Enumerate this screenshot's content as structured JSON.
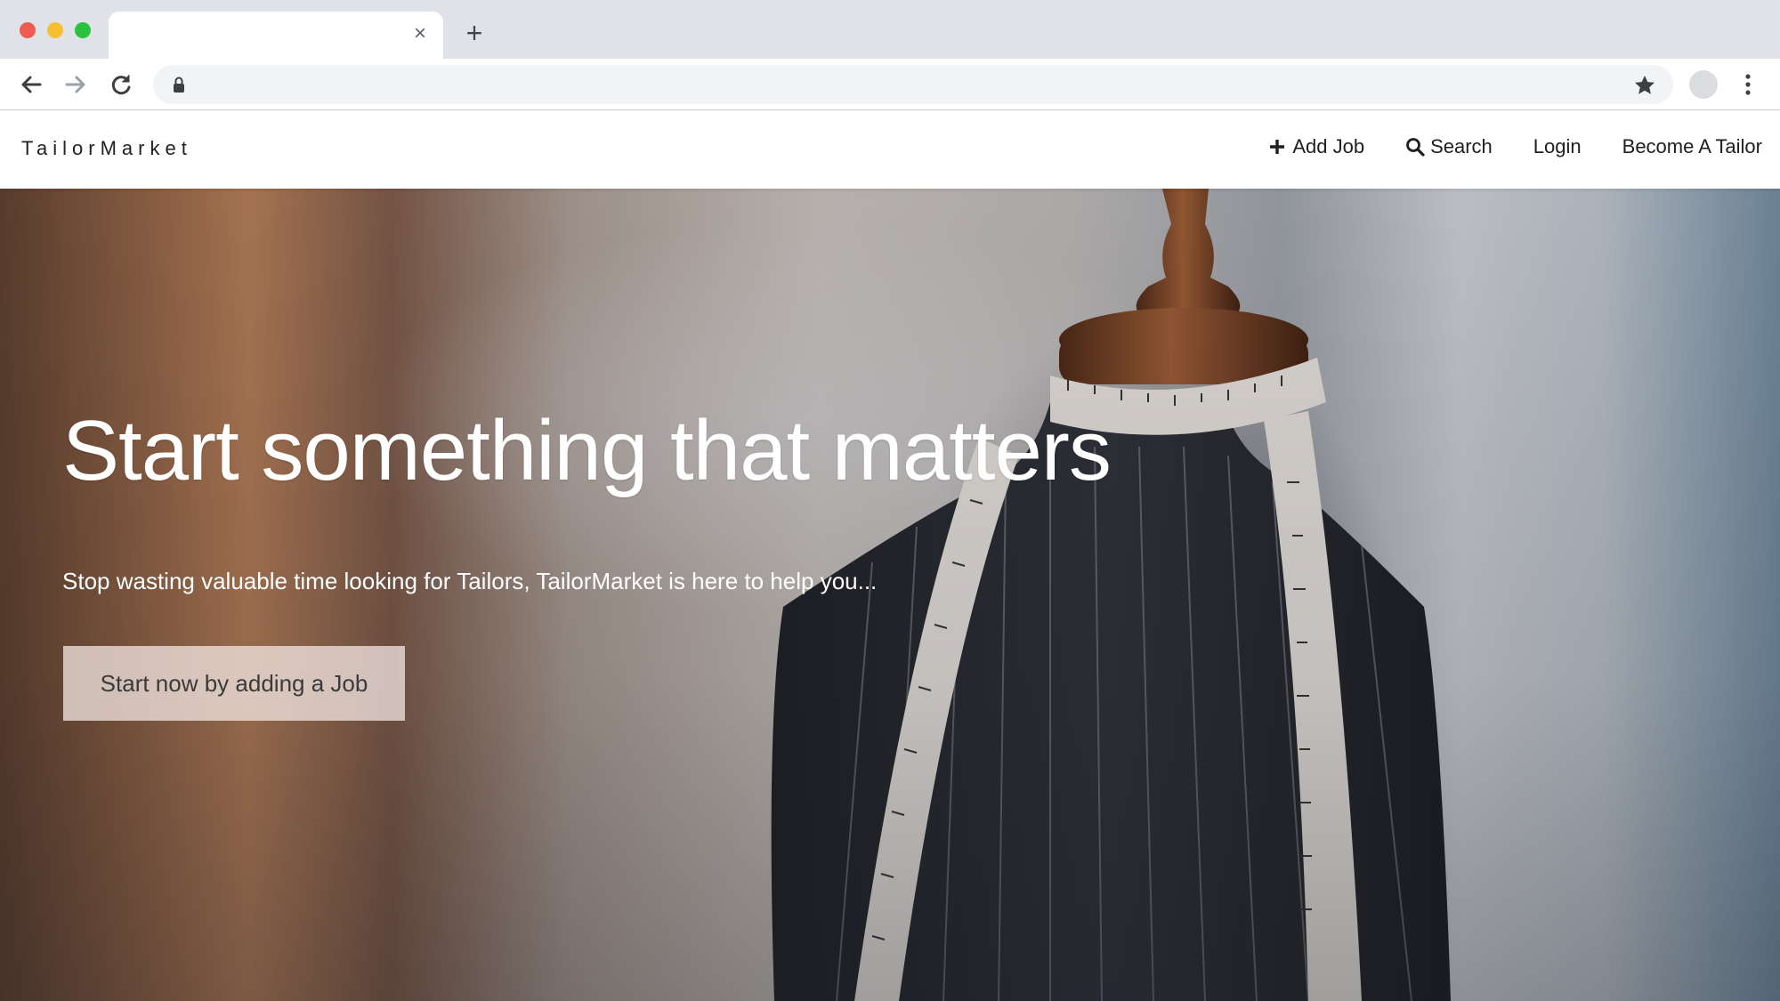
{
  "browser": {
    "tab_title": "",
    "tab_close": "×",
    "new_tab": "+",
    "address": ""
  },
  "site": {
    "brand": "TailorMarket",
    "nav": [
      {
        "label": "Add Job",
        "icon": "plus-icon"
      },
      {
        "label": "Search",
        "icon": "search-icon"
      },
      {
        "label": "Login"
      },
      {
        "label": "Become A Tailor"
      }
    ]
  },
  "hero": {
    "title": "Start something that matters",
    "subtitle": "Stop wasting valuable time looking for Tailors, TailorMarket is here to help you...",
    "cta": "Start now by adding a Job"
  },
  "colors": {
    "close": "#ee5b52",
    "minimize": "#f6be31",
    "maximize": "#29c13f",
    "tape": "#e6e2de",
    "suit": "#23272f",
    "wood": "#7a3f1f"
  }
}
